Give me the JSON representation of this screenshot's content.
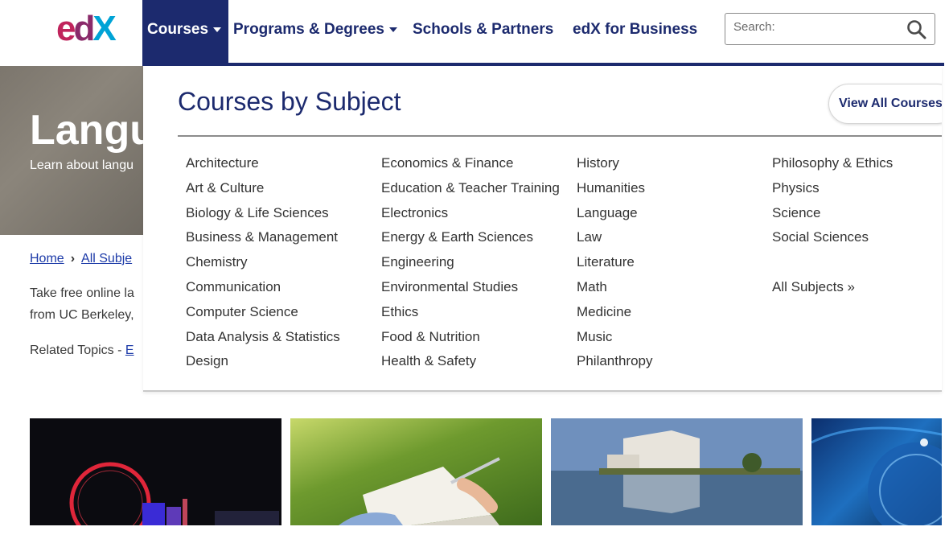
{
  "header": {
    "logo": {
      "e": "e",
      "d": "d",
      "x": "X"
    },
    "nav": {
      "courses": "Courses",
      "programs": "Programs & Degrees",
      "schools": "Schools & Partners",
      "business": "edX for Business"
    },
    "search": {
      "placeholder": "Search:",
      "value": ""
    },
    "accent_color": "#1c2a6e"
  },
  "hero": {
    "title": "Langu",
    "subtitle": "Learn about langu"
  },
  "page_behind": {
    "breadcrumb_home": "Home",
    "breadcrumb_all": "All Subje",
    "intro_line1": "Take free online la",
    "intro_line2": "from UC Berkeley,",
    "related_prefix": "Related Topics - ",
    "related_link": "E"
  },
  "mega_menu": {
    "title": "Courses by Subject",
    "view_all": "View All Courses",
    "columns": [
      [
        "Architecture",
        "Art & Culture",
        "Biology & Life Sciences",
        "Business & Management",
        "Chemistry",
        "Communication",
        "Computer Science",
        "Data Analysis & Statistics",
        "Design"
      ],
      [
        "Economics & Finance",
        "Education & Teacher Training",
        "Electronics",
        "Energy & Earth Sciences",
        "Engineering",
        "Environmental Studies",
        "Ethics",
        "Food & Nutrition",
        "Health & Safety"
      ],
      [
        "History",
        "Humanities",
        "Language",
        "Law",
        "Literature",
        "Math",
        "Medicine",
        "Music",
        "Philanthropy"
      ],
      [
        "Philosophy & Ethics",
        "Physics",
        "Science",
        "Social Sciences"
      ]
    ],
    "all_subjects": "All Subjects »"
  }
}
